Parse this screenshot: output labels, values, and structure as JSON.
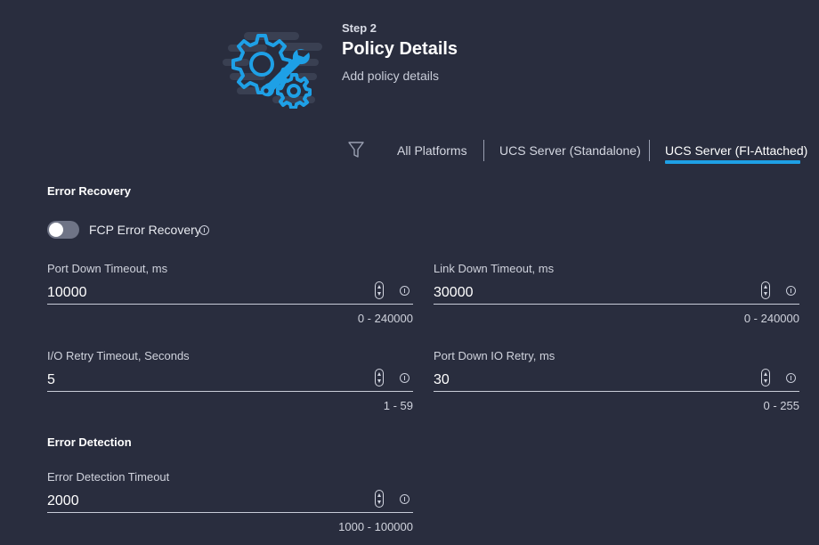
{
  "header": {
    "step_label": "Step 2",
    "title": "Policy Details",
    "subtitle": "Add policy details",
    "hero_icon": "gear-wrench-icon"
  },
  "platform_filter": {
    "icon": "filter-icon",
    "tabs": [
      {
        "label": "All Platforms",
        "active": false
      },
      {
        "label": "UCS Server (Standalone)",
        "active": false
      },
      {
        "label": "UCS Server (FI-Attached)",
        "active": true
      }
    ]
  },
  "error_recovery": {
    "heading": "Error Recovery",
    "fcp_toggle": {
      "label": "FCP Error Recovery",
      "enabled": false
    },
    "fields": {
      "port_down_timeout": {
        "label": "Port Down Timeout, ms",
        "value": "10000",
        "range": "0 - 240000"
      },
      "link_down_timeout": {
        "label": "Link Down Timeout, ms",
        "value": "30000",
        "range": "0 - 240000"
      },
      "io_retry_timeout": {
        "label": "I/O Retry Timeout, Seconds",
        "value": "5",
        "range": "1 - 59"
      },
      "port_down_io_retry": {
        "label": "Port Down IO Retry, ms",
        "value": "30",
        "range": "0 - 255"
      }
    }
  },
  "error_detection": {
    "heading": "Error Detection",
    "fields": {
      "error_detection_timeout": {
        "label": "Error Detection Timeout",
        "value": "2000",
        "range": "1000 - 100000"
      }
    }
  },
  "colors": {
    "background": "#292d3e",
    "accent": "#1ea0e6",
    "text": "#e8eaf0"
  }
}
